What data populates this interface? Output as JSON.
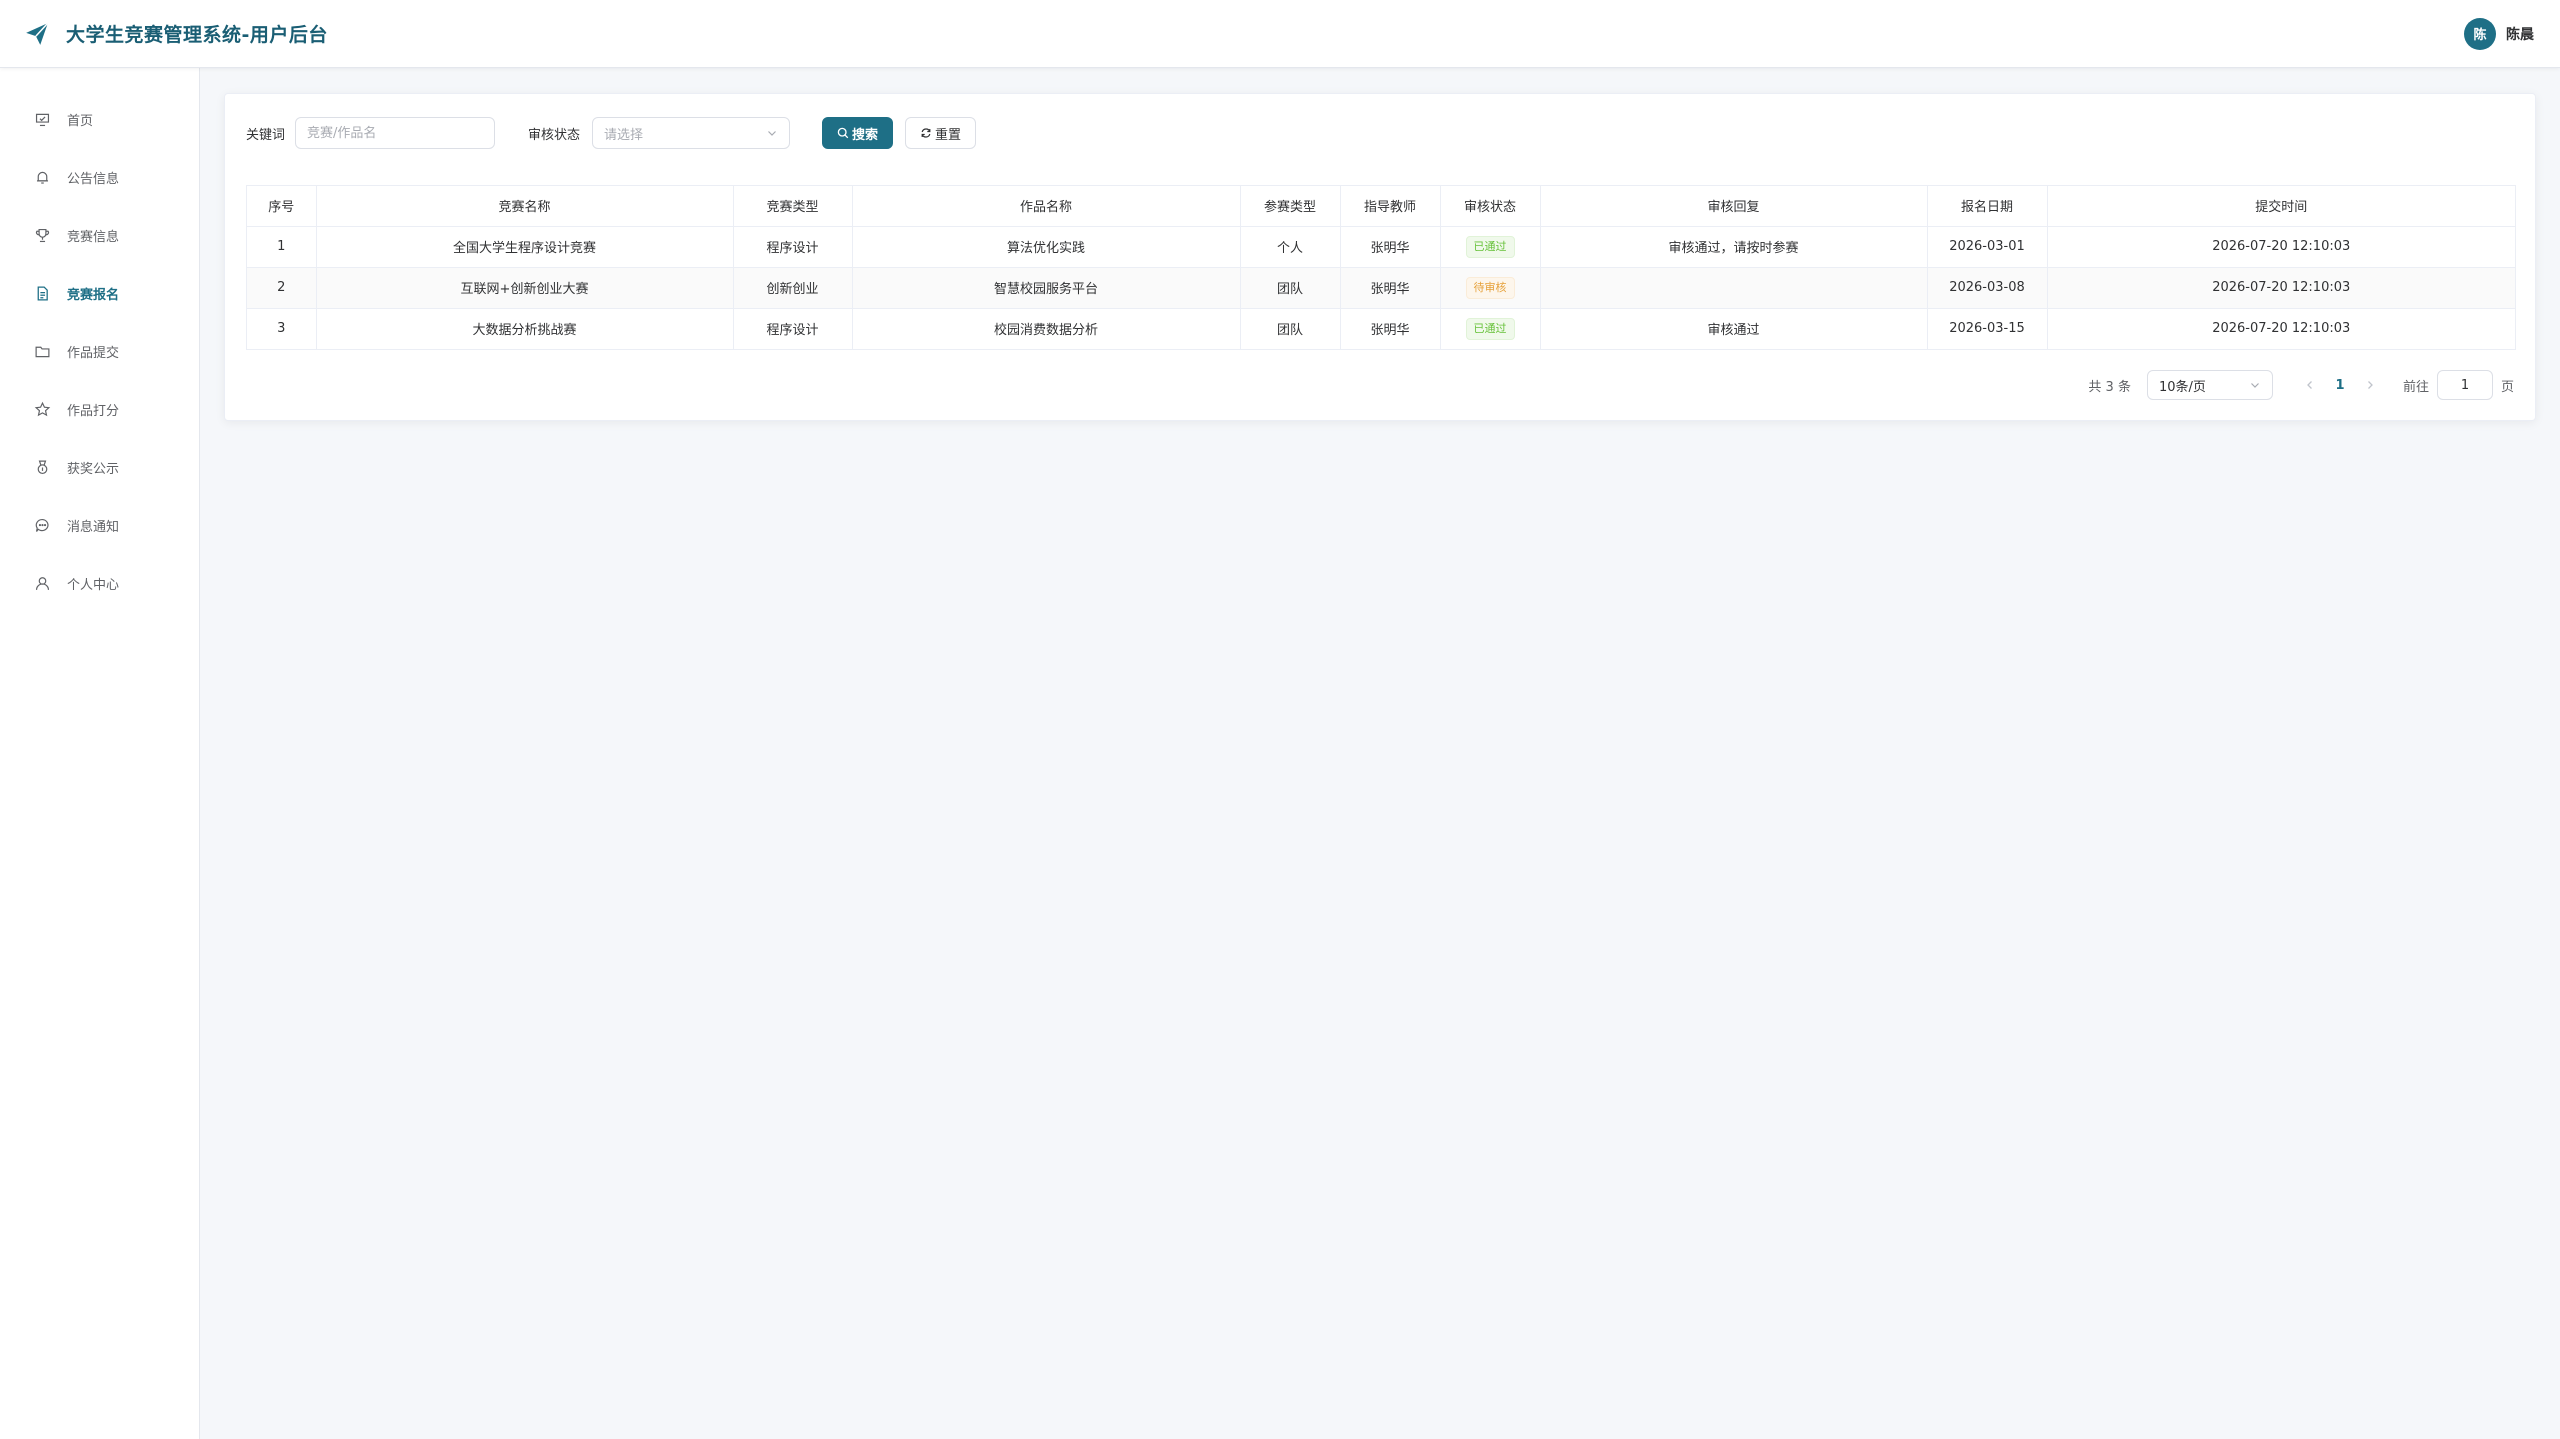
{
  "header": {
    "title": "大学生竞赛管理系统-用户后台",
    "logo_icon": "paper-plane-icon",
    "user": {
      "avatar_text": "陈",
      "name": "陈晨"
    }
  },
  "colors": {
    "accent": "#1e6f86",
    "success": "#67c23a",
    "warning": "#e6a23c"
  },
  "sidebar": {
    "items": [
      {
        "label": "首页",
        "icon": "home-icon",
        "active": false
      },
      {
        "label": "公告信息",
        "icon": "bell-icon",
        "active": false
      },
      {
        "label": "竞赛信息",
        "icon": "trophy-icon",
        "active": false
      },
      {
        "label": "竞赛报名",
        "icon": "document-icon",
        "active": true
      },
      {
        "label": "作品提交",
        "icon": "folder-icon",
        "active": false
      },
      {
        "label": "作品打分",
        "icon": "star-icon",
        "active": false
      },
      {
        "label": "获奖公示",
        "icon": "medal-icon",
        "active": false
      },
      {
        "label": "消息通知",
        "icon": "chat-icon",
        "active": false
      },
      {
        "label": "个人中心",
        "icon": "user-icon",
        "active": false
      }
    ]
  },
  "search": {
    "keyword_label": "关键词",
    "keyword_placeholder": "竞赛/作品名",
    "status_label": "审核状态",
    "status_placeholder": "请选择",
    "search_button": "搜索",
    "reset_button": "重置"
  },
  "table": {
    "columns": [
      "序号",
      "竞赛名称",
      "竞赛类型",
      "作品名称",
      "参赛类型",
      "指导教师",
      "审核状态",
      "审核回复",
      "报名日期",
      "提交时间"
    ],
    "rows": [
      {
        "index": "1",
        "competition": "全国大学生程序设计竞赛",
        "type": "程序设计",
        "work": "算法优化实践",
        "participation": "个人",
        "teacher": "张明华",
        "status": "已通过",
        "status_kind": "success",
        "reply": "审核通过，请按时参赛",
        "date": "2026-03-01",
        "submitted": "2026-07-20 12:10:03"
      },
      {
        "index": "2",
        "competition": "互联网+创新创业大赛",
        "type": "创新创业",
        "work": "智慧校园服务平台",
        "participation": "团队",
        "teacher": "张明华",
        "status": "待审核",
        "status_kind": "warning",
        "reply": "",
        "date": "2026-03-08",
        "submitted": "2026-07-20 12:10:03"
      },
      {
        "index": "3",
        "competition": "大数据分析挑战赛",
        "type": "程序设计",
        "work": "校园消费数据分析",
        "participation": "团队",
        "teacher": "张明华",
        "status": "已通过",
        "status_kind": "success",
        "reply": "审核通过",
        "date": "2026-03-15",
        "submitted": "2026-07-20 12:10:03"
      }
    ]
  },
  "pagination": {
    "total_text": "共 3 条",
    "page_size": "10条/页",
    "current_page": "1",
    "goto_label": "前往",
    "goto_value": "1",
    "page_suffix": "页"
  }
}
